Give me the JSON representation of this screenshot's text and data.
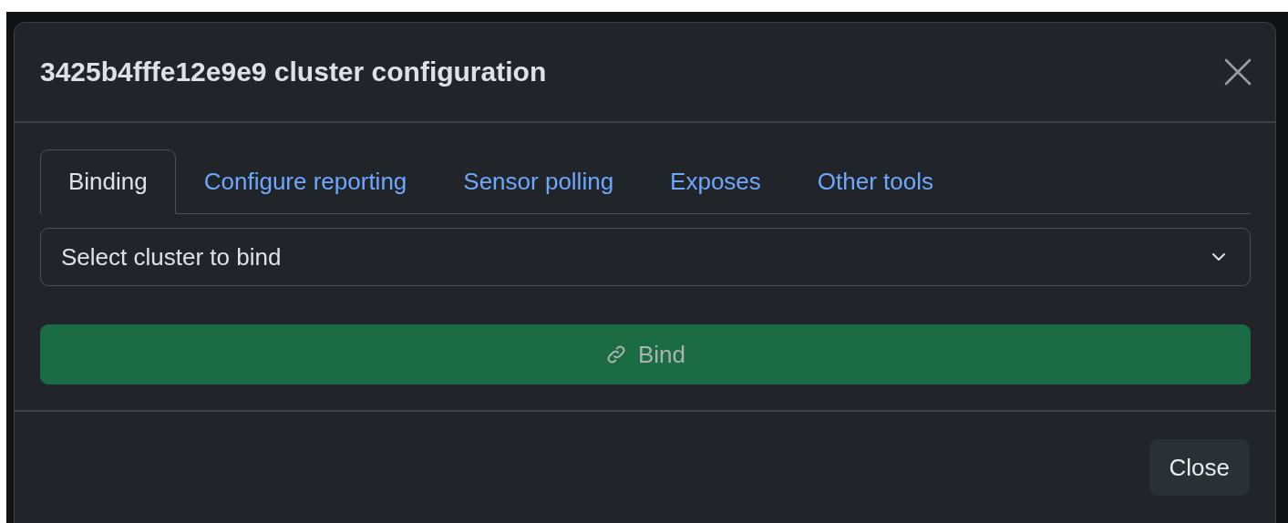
{
  "dialog": {
    "title": "3425b4fffe12e9e9 cluster configuration"
  },
  "tabs": [
    {
      "label": "Binding",
      "selected": true
    },
    {
      "label": "Configure reporting",
      "selected": false
    },
    {
      "label": "Sensor polling",
      "selected": false
    },
    {
      "label": "Exposes",
      "selected": false
    },
    {
      "label": "Other tools",
      "selected": false
    }
  ],
  "cluster_select": {
    "value": "Select cluster to bind"
  },
  "bind_button": {
    "label": "Bind",
    "disabled": true
  },
  "footer": {
    "close_button": "Close"
  }
}
